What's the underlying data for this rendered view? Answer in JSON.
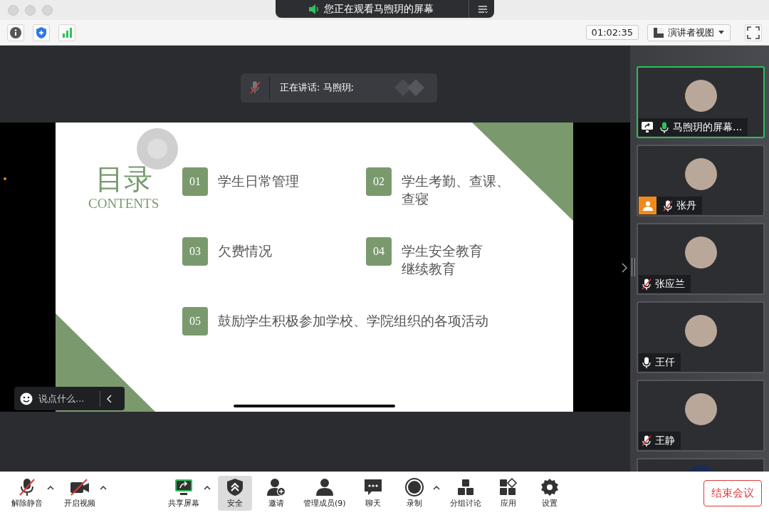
{
  "window": {
    "title": "您正在观看马煦玥的屏幕"
  },
  "toolbar": {
    "timer": "01:02:35",
    "view_menu": "演讲者视图"
  },
  "speaker_banner": {
    "text": "正在讲话: 马煦玥;",
    "mic_muted": true
  },
  "slide": {
    "title": "目录",
    "subtitle": "CONTENTS",
    "items": [
      {
        "number": "01",
        "lines": [
          "学生日常管理"
        ]
      },
      {
        "number": "02",
        "lines": [
          "学生考勤、查课、",
          "查寝"
        ]
      },
      {
        "number": "03",
        "lines": [
          "欠费情况"
        ]
      },
      {
        "number": "04",
        "lines": [
          "学生安全教育",
          "继续教育"
        ]
      },
      {
        "number": "05",
        "lines": [
          "鼓励学生积极参加学校、学院组织的各项活动"
        ]
      }
    ]
  },
  "chat_input": {
    "placeholder": "说点什么..."
  },
  "participants": [
    {
      "name": "马煦玥的屏幕...",
      "muted": false,
      "speaking": true,
      "sharing": true,
      "host": false,
      "selected": true
    },
    {
      "name": "张丹",
      "muted": true,
      "speaking": false,
      "sharing": false,
      "host": true,
      "selected": false
    },
    {
      "name": "张应兰",
      "muted": true,
      "speaking": false,
      "sharing": false,
      "host": false,
      "selected": false
    },
    {
      "name": "王仟",
      "muted": false,
      "speaking": false,
      "sharing": false,
      "host": false,
      "selected": false
    },
    {
      "name": "王静",
      "muted": true,
      "speaking": false,
      "sharing": false,
      "host": false,
      "selected": false
    },
    {
      "selected": false
    }
  ],
  "bottom_bar": [
    {
      "kind": "mic",
      "label": "解除静音",
      "has_menu": true,
      "selected": false
    },
    {
      "kind": "video",
      "label": "开启视频",
      "has_menu": true,
      "selected": false
    },
    {
      "kind": "share",
      "label": "共享屏幕",
      "has_menu": true,
      "selected": false
    },
    {
      "kind": "security",
      "label": "安全",
      "has_menu": false,
      "selected": true
    },
    {
      "kind": "invite",
      "label": "邀请",
      "has_menu": false,
      "selected": false
    },
    {
      "kind": "members",
      "label": "管理成员(9)",
      "has_menu": false,
      "selected": false
    },
    {
      "kind": "chat",
      "label": "聊天",
      "has_menu": false,
      "selected": false
    },
    {
      "kind": "record",
      "label": "录制",
      "has_menu": true,
      "selected": false
    },
    {
      "kind": "breakout",
      "label": "分组讨论",
      "has_menu": false,
      "selected": false
    },
    {
      "kind": "apps",
      "label": "应用",
      "has_menu": false,
      "selected": false
    },
    {
      "kind": "settings",
      "label": "设置",
      "has_menu": false,
      "selected": false
    }
  ],
  "end_button": "结束会议"
}
